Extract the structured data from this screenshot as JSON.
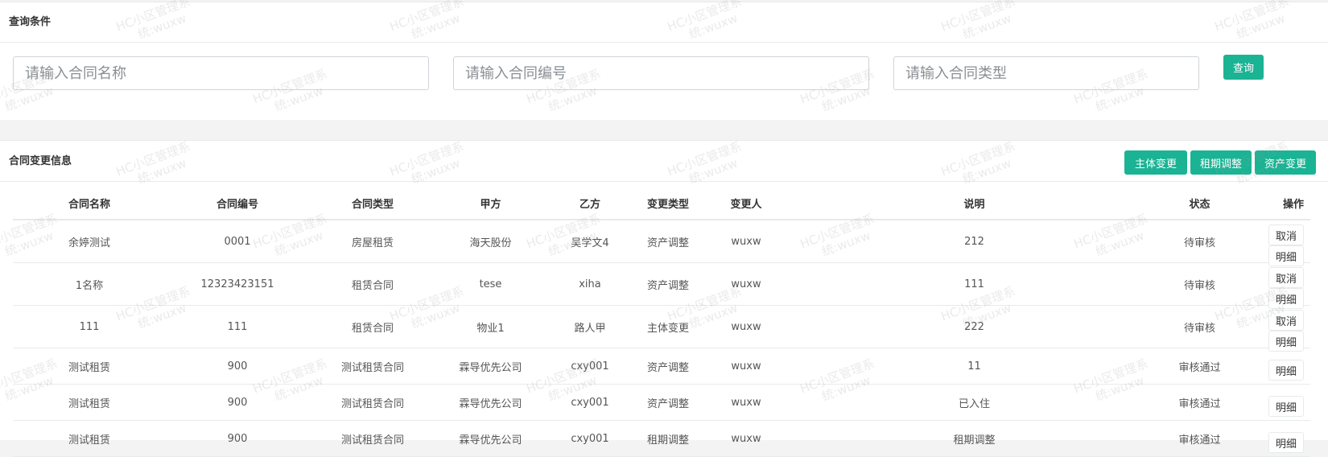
{
  "search_panel": {
    "title": "查询条件",
    "contract_name_placeholder": "请输入合同名称",
    "contract_code_placeholder": "请输入合同编号",
    "contract_type_placeholder": "请输入合同类型",
    "query_label": "查询"
  },
  "list_panel": {
    "title": "合同变更信息",
    "toolbar": {
      "subject_change_label": "主体变更",
      "lease_adjust_label": "租期调整",
      "asset_change_label": "资产变更"
    },
    "columns": [
      "合同名称",
      "合同编号",
      "合同类型",
      "甲方",
      "乙方",
      "变更类型",
      "变更人",
      "说明",
      "状态",
      "操作"
    ],
    "rows": [
      {
        "name": "余婷测试",
        "code": "0001",
        "type": "房屋租赁",
        "party_a": "海天股份",
        "party_b": "吴学文4",
        "change_type": "资产调整",
        "changer": "wuxw",
        "remark": "212",
        "status": "待审核",
        "cancel": "取消",
        "detail": "明细"
      },
      {
        "name": "1名称",
        "code": "12323423151",
        "type": "租赁合同",
        "party_a": "tese",
        "party_b": "xiha",
        "change_type": "资产调整",
        "changer": "wuxw",
        "remark": "111",
        "status": "待审核",
        "cancel": "取消",
        "detail": "明细"
      },
      {
        "name": "111",
        "code": "111",
        "type": "租赁合同",
        "party_a": "物业1",
        "party_b": "路人甲",
        "change_type": "主体变更",
        "changer": "wuxw",
        "remark": "222",
        "status": "待审核",
        "cancel": "取消",
        "detail": "明细"
      },
      {
        "name": "测试租赁",
        "code": "900",
        "type": "测试租赁合同",
        "party_a": "霖导优先公司",
        "party_b": "cxy001",
        "change_type": "资产调整",
        "changer": "wuxw",
        "remark": "11",
        "status": "审核通过",
        "cancel": "",
        "detail": "明细"
      },
      {
        "name": "测试租赁",
        "code": "900",
        "type": "测试租赁合同",
        "party_a": "霖导优先公司",
        "party_b": "cxy001",
        "change_type": "资产调整",
        "changer": "wuxw",
        "remark": "已入住",
        "status": "审核通过",
        "cancel": "",
        "detail": "明细"
      },
      {
        "name": "测试租赁",
        "code": "900",
        "type": "测试租赁合同",
        "party_a": "霖导优先公司",
        "party_b": "cxy001",
        "change_type": "租期调整",
        "changer": "wuxw",
        "remark": "租期调整",
        "status": "审核通过",
        "cancel": "",
        "detail": "明细"
      }
    ]
  },
  "watermark": {
    "line1": "HC小区管理系",
    "line2": "统:wuxw"
  },
  "colors": {
    "accent": "#1ab394",
    "border": "#e7eaec",
    "background": "#f3f3f4"
  }
}
